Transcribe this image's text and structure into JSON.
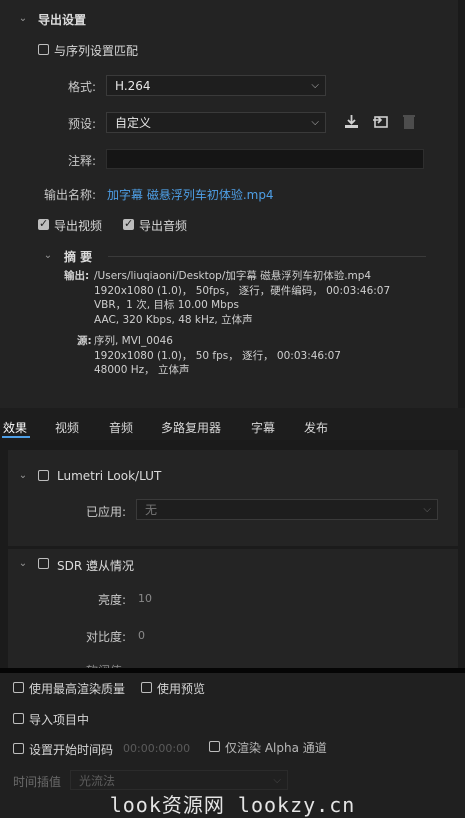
{
  "export_settings": {
    "section_title": "导出设置",
    "match_sequence_label": "与序列设置匹配",
    "format_label": "格式:",
    "format_value": "H.264",
    "preset_label": "预设:",
    "preset_value": "自定义",
    "comment_label": "注释:",
    "comment_value": "",
    "output_name_label": "输出名称:",
    "output_name_value": "加字幕 磁悬浮列车初体验.mp4",
    "export_video_label": "导出视频",
    "export_audio_label": "导出音频",
    "summary_title": "摘 要",
    "summary": {
      "output_label": "输出:",
      "output_lines": [
        "/Users/liuqiaoni/Desktop/加字幕 磁悬浮列车初体验.mp4",
        "1920x1080 (1.0)，  50fps，  逐行，硬件编码，  00:03:46:07",
        "VBR，1 次, 目标 10.00 Mbps",
        "AAC, 320 Kbps, 48  kHz, 立体声"
      ],
      "source_label": "源:",
      "source_lines": [
        "序列, MVI_0046",
        "1920x1080 (1.0)，  50 fps，  逐行，  00:03:46:07",
        "48000 Hz，  立体声"
      ]
    }
  },
  "tabs": [
    "效果",
    "视频",
    "音频",
    "多路复用器",
    "字幕",
    "发布"
  ],
  "effects": {
    "lumetri_label": "Lumetri Look/LUT",
    "applied_label": "已应用:",
    "applied_value": "无",
    "sdr_label": "SDR 遵从情况",
    "brightness_label": "亮度:",
    "brightness_value": "10",
    "contrast_label": "对比度:",
    "contrast_value": "0",
    "partial_label": "软阈值:"
  },
  "bottom": {
    "max_render_quality_label": "使用最高渲染质量",
    "use_previews_label": "使用预览",
    "import_into_project_label": "导入项目中",
    "set_start_timecode_label": "设置开始时间码",
    "start_timecode_value": "00:00:00:00",
    "render_alpha_only_label": "仅渲染 Alpha 通道",
    "time_interpolation_label": "时间插值",
    "time_interpolation_value": "光流法"
  },
  "watermark": "look资源网 lookzy.cn"
}
